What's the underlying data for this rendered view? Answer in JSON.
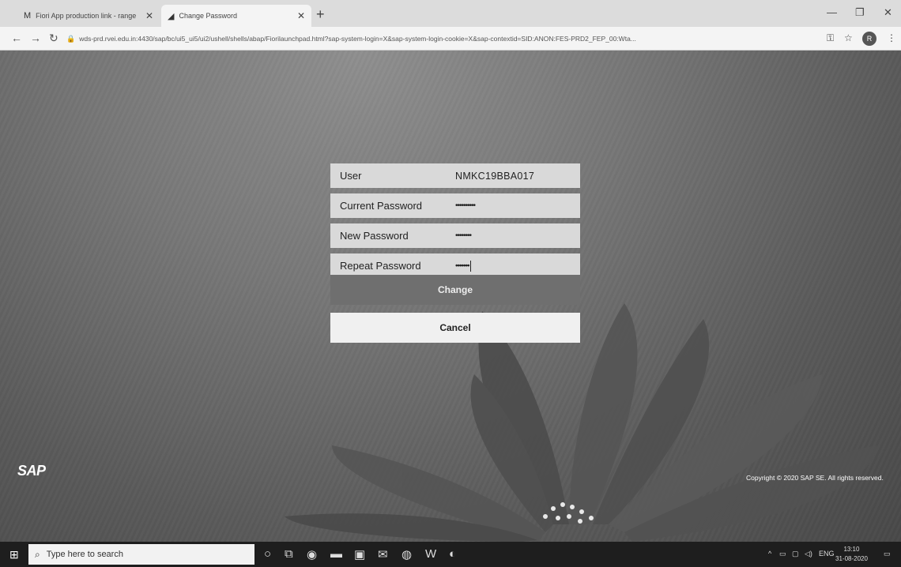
{
  "browser": {
    "tabs": [
      {
        "label": "Fiori App production link - range",
        "icon": "mail-icon"
      },
      {
        "label": "Change Password",
        "icon": "sap-icon"
      }
    ],
    "url": "wds-prd.rvei.edu.in:4430/sap/bc/ui5_ui5/ui2/ushell/shells/abap/Fiorilaunchpad.html?sap-system-login=X&sap-system-login-cookie=X&sap-contextid=SID:ANON:FES-PRD2_FEP_00:Wta...",
    "profile_initial": "R"
  },
  "form": {
    "fields": [
      {
        "label": "User",
        "value": "NMKC19BBA017"
      },
      {
        "label": "Current Password",
        "value": "••••••••••"
      },
      {
        "label": "New Password",
        "value": "••••••••"
      },
      {
        "label": "Repeat Password",
        "value": "•••••••"
      }
    ],
    "change_label": "Change",
    "cancel_label": "Cancel"
  },
  "footer": {
    "logo": "SAP",
    "copyright": "Copyright © 2020 SAP SE. All rights reserved."
  },
  "taskbar": {
    "search_placeholder": "Type here to search",
    "tray_lang": "ENG",
    "time": "13:10",
    "date": "31-08-2020"
  }
}
